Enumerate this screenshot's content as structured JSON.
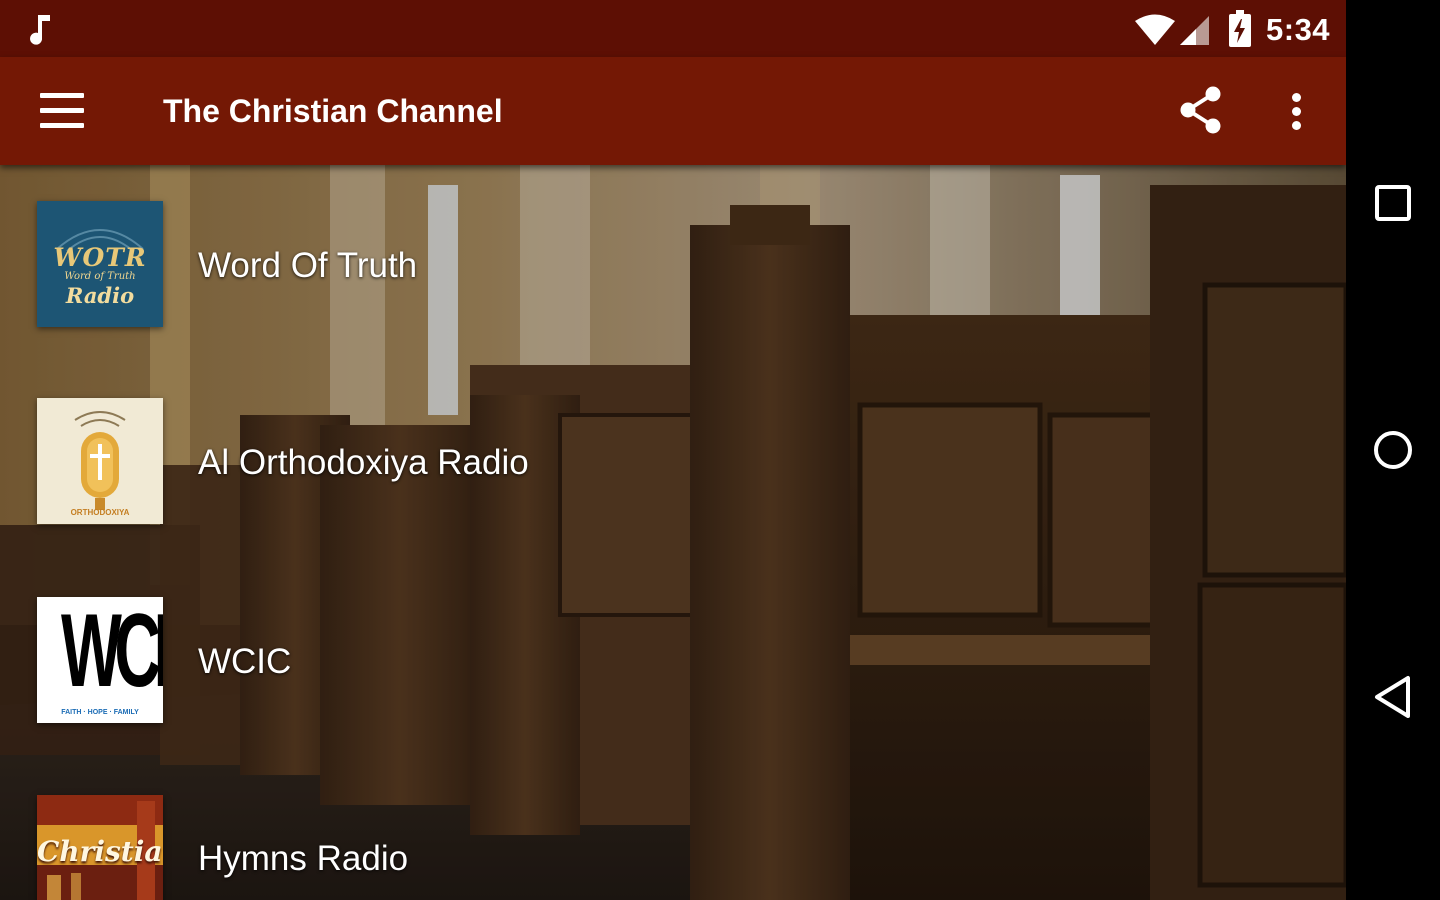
{
  "status_bar": {
    "time": "5:34",
    "icons": [
      "music-note-icon",
      "wifi-icon",
      "signal-icon",
      "battery-charging-icon"
    ],
    "color": "#5d0f04"
  },
  "toolbar": {
    "title": "The Christian Channel",
    "color": "#741805",
    "icons": [
      "menu-icon",
      "share-icon",
      "more-vert-icon"
    ]
  },
  "stations": [
    {
      "name": "Word Of Truth",
      "logo": {
        "line1": "WOTR",
        "line2": "Word of Truth",
        "line3": "Radio"
      }
    },
    {
      "name": "Al Orthodoxiya Radio",
      "logo": {
        "caption": "ORTHODOXIYA"
      }
    },
    {
      "name": "WCIC",
      "logo": {
        "text": "WCIC",
        "tagline": "FAITH · HOPE · FAMILY"
      }
    },
    {
      "name": "Hymns Radio",
      "logo": {
        "text": "Christian"
      }
    }
  ],
  "nav_bar": {
    "buttons": [
      "recent-apps-icon",
      "home-icon",
      "back-icon"
    ]
  }
}
